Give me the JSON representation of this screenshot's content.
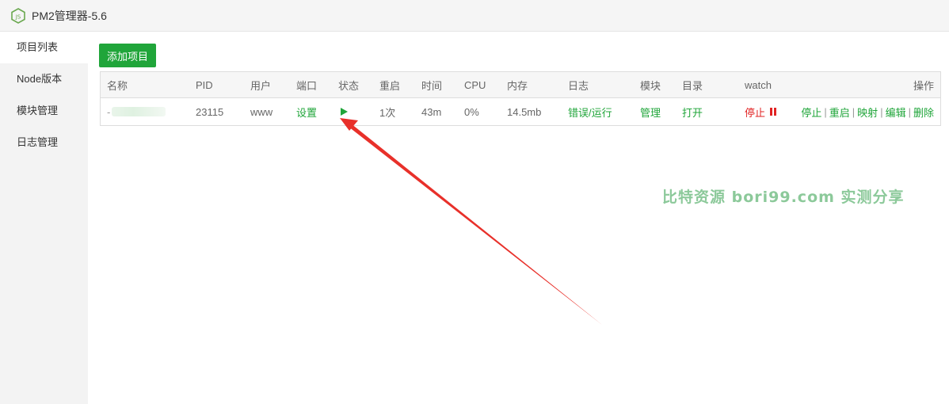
{
  "window": {
    "title": "PM2管理器-5.6",
    "icon": "nodejs-icon"
  },
  "sidebar": {
    "items": [
      {
        "label": "项目列表",
        "active": true
      },
      {
        "label": "Node版本",
        "active": false
      },
      {
        "label": "模块管理",
        "active": false
      },
      {
        "label": "日志管理",
        "active": false
      }
    ]
  },
  "toolbar": {
    "add_label": "添加项目"
  },
  "table": {
    "headers": {
      "name": "名称",
      "pid": "PID",
      "user": "用户",
      "port": "端口",
      "status": "状态",
      "restart": "重启",
      "time": "时间",
      "cpu": "CPU",
      "mem": "内存",
      "log": "日志",
      "module": "模块",
      "dir": "目录",
      "watch": "watch",
      "ops": "操作"
    },
    "rows": [
      {
        "name": "-",
        "pid": "23115",
        "user": "www",
        "port": "设置",
        "status_icon": "play-icon",
        "restart": "1次",
        "time": "43m",
        "cpu": "0%",
        "mem": "14.5mb",
        "log": "错误/运行",
        "module": "管理",
        "dir": "打开",
        "watch": "停止",
        "ops": {
          "stop": "停止",
          "restart": "重启",
          "map": "映射",
          "edit": "编辑",
          "delete": "删除",
          "separator": "|"
        }
      }
    ]
  },
  "watermark": "比特资源 bori99.com 实测分享",
  "colors": {
    "accent": "#20a53a",
    "danger": "#e12323",
    "arrow": "#e8302a"
  }
}
